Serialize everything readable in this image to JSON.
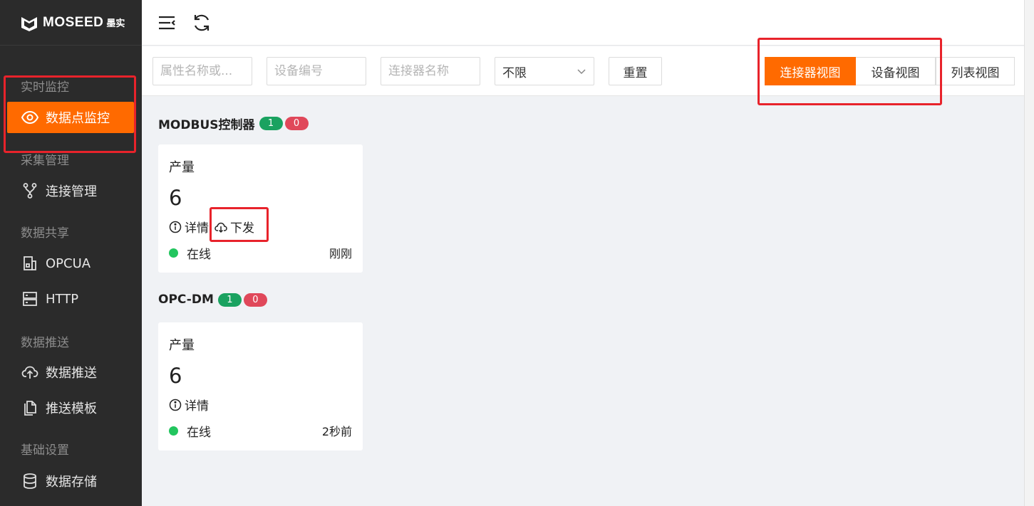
{
  "brand": {
    "name": "MOSEED",
    "cn": "墨实"
  },
  "sidebar": {
    "groups": [
      {
        "label": "实时监控",
        "items": [
          {
            "label": "数据点监控",
            "icon": "eye-icon",
            "active": true
          }
        ]
      },
      {
        "label": "采集管理",
        "items": [
          {
            "label": "连接管理",
            "icon": "branch-icon"
          }
        ]
      },
      {
        "label": "数据共享",
        "items": [
          {
            "label": "OPCUA",
            "icon": "building-icon"
          },
          {
            "label": "HTTP",
            "icon": "server-icon"
          }
        ]
      },
      {
        "label": "数据推送",
        "items": [
          {
            "label": "数据推送",
            "icon": "cloud-upload-icon"
          },
          {
            "label": "推送模板",
            "icon": "copy-icon"
          }
        ]
      },
      {
        "label": "基础设置",
        "items": [
          {
            "label": "数据存储",
            "icon": "database-icon"
          }
        ]
      }
    ]
  },
  "header": {
    "menu_icon": "menu-fold-icon",
    "refresh_icon": "refresh-icon"
  },
  "filters": {
    "attr_placeholder": "属性名称或...",
    "device_placeholder": "设备编号",
    "connector_placeholder": "连接器名称",
    "select_value": "不限",
    "reset_label": "重置"
  },
  "views": {
    "connector": "连接器视图",
    "device": "设备视图",
    "list": "列表视图",
    "active": "connector"
  },
  "sections": [
    {
      "title": "MODBUS控制器",
      "online_count": "1",
      "offline_count": "0",
      "card": {
        "label": "产量",
        "value": "6",
        "detail": "详情",
        "issue": "下发",
        "status": "在线",
        "time": "刚刚"
      }
    },
    {
      "title": "OPC-DM",
      "online_count": "1",
      "offline_count": "0",
      "card": {
        "label": "产量",
        "value": "6",
        "detail": "详情",
        "status": "在线",
        "time": "2秒前"
      }
    }
  ],
  "colors": {
    "accent": "#ff6a00",
    "sidebar_bg": "#2b2b2b",
    "online": "#22c55e",
    "badge_green": "#1aa260",
    "badge_red": "#e0485a",
    "annotation": "#e8232b"
  }
}
